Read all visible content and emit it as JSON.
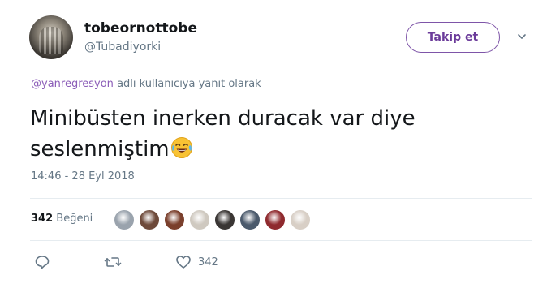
{
  "author": {
    "display_name": "tobeornottobe",
    "handle": "@Tubadiyorki",
    "avatar_icon": "avatar"
  },
  "follow_button": {
    "label": "Takip et"
  },
  "reply_context": {
    "mention": "@yanregresyon",
    "suffix": " adlı kullanıcıya yanıt olarak"
  },
  "tweet": {
    "text_line1": "Minibüsten inerken duracak var diye",
    "text_line2": "seslenmiştim",
    "emoji": "face-with-tears-of-joy",
    "timestamp": "14:46 - 28 Eyl 2018"
  },
  "stats": {
    "likes_number": "342",
    "likes_label": "Beğeni",
    "liker_colors": [
      "#9aa3ad",
      "#6e4a3a",
      "#7a3f2c",
      "#cfc9c0",
      "#3a3634",
      "#4b5a6c",
      "#8f2a2e",
      "#d8cfc6"
    ]
  },
  "actions": {
    "reply_icon": "reply-icon",
    "retweet_icon": "retweet-icon",
    "like_icon": "heart-icon",
    "like_count": "342"
  },
  "colors": {
    "accent": "#7e55a8",
    "muted": "#657786",
    "text": "#14171a"
  }
}
